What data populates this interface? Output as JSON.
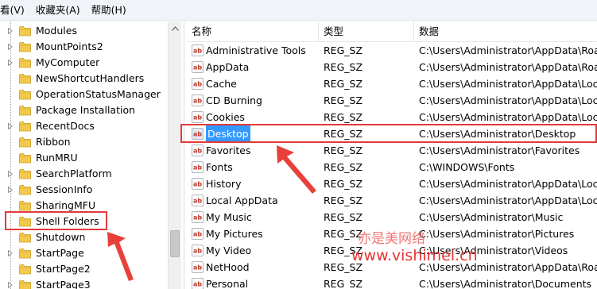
{
  "menu": [
    {
      "label": "看(V)"
    },
    {
      "label": "收藏夹(A)"
    },
    {
      "label": "帮助(H)"
    }
  ],
  "tree": {
    "items": [
      {
        "label": "Modules",
        "expandable": true
      },
      {
        "label": "MountPoints2",
        "expandable": true
      },
      {
        "label": "MyComputer",
        "expandable": true
      },
      {
        "label": "NewShortcutHandlers",
        "expandable": false
      },
      {
        "label": "OperationStatusManager",
        "expandable": false
      },
      {
        "label": "Package Installation",
        "expandable": false
      },
      {
        "label": "RecentDocs",
        "expandable": true
      },
      {
        "label": "Ribbon",
        "expandable": false
      },
      {
        "label": "RunMRU",
        "expandable": false
      },
      {
        "label": "SearchPlatform",
        "expandable": true
      },
      {
        "label": "SessionInfo",
        "expandable": true
      },
      {
        "label": "SharingMFU",
        "expandable": false
      },
      {
        "label": "Shell Folders",
        "expandable": false,
        "selected": true
      },
      {
        "label": "Shutdown",
        "expandable": false
      },
      {
        "label": "StartPage",
        "expandable": true
      },
      {
        "label": "StartPage2",
        "expandable": false
      },
      {
        "label": "StartPage3",
        "expandable": true
      }
    ]
  },
  "list": {
    "columns": {
      "name": "名称",
      "type": "类型",
      "data": "数据"
    },
    "rows": [
      {
        "name": "Administrative Tools",
        "type": "REG_SZ",
        "data": "C:\\Users\\Administrator\\AppData\\Roam"
      },
      {
        "name": "AppData",
        "type": "REG_SZ",
        "data": "C:\\Users\\Administrator\\AppData\\Roam"
      },
      {
        "name": "Cache",
        "type": "REG_SZ",
        "data": "C:\\Users\\Administrator\\AppData\\Local"
      },
      {
        "name": "CD Burning",
        "type": "REG_SZ",
        "data": "C:\\Users\\Administrator\\AppData\\Local"
      },
      {
        "name": "Cookies",
        "type": "REG_SZ",
        "data": "C:\\Users\\Administrator\\AppData\\Local"
      },
      {
        "name": "Desktop",
        "type": "REG_SZ",
        "data": "C:\\Users\\Administrator\\Desktop",
        "selected": true
      },
      {
        "name": "Favorites",
        "type": "REG_SZ",
        "data": "C:\\Users\\Administrator\\Favorites"
      },
      {
        "name": "Fonts",
        "type": "REG_SZ",
        "data": "C:\\WINDOWS\\Fonts"
      },
      {
        "name": "History",
        "type": "REG_SZ",
        "data": "C:\\Users\\Administrator\\AppData\\Local"
      },
      {
        "name": "Local AppData",
        "type": "REG_SZ",
        "data": "C:\\Users\\Administrator\\AppData\\Local"
      },
      {
        "name": "My Music",
        "type": "REG_SZ",
        "data": "C:\\Users\\Administrator\\Music"
      },
      {
        "name": "My Pictures",
        "type": "REG_SZ",
        "data": "C:\\Users\\Administrator\\Pictures"
      },
      {
        "name": "My Video",
        "type": "REG_SZ",
        "data": "C:\\Users\\Administrator\\Videos"
      },
      {
        "name": "NetHood",
        "type": "REG_SZ",
        "data": "C:\\Users\\Administrator\\AppData\\Roam"
      },
      {
        "name": "Personal",
        "type": "REG_SZ",
        "data": "C:\\Users\\Administrator\\Documents"
      }
    ]
  },
  "watermark": {
    "line1": "亦是美网络",
    "line2": "www.vishimei.cn"
  },
  "colors": {
    "selection": "#3399ff",
    "highlight_box": "#e23a3a",
    "folder": "#f2c94c",
    "value_icon": "#c0392b"
  }
}
